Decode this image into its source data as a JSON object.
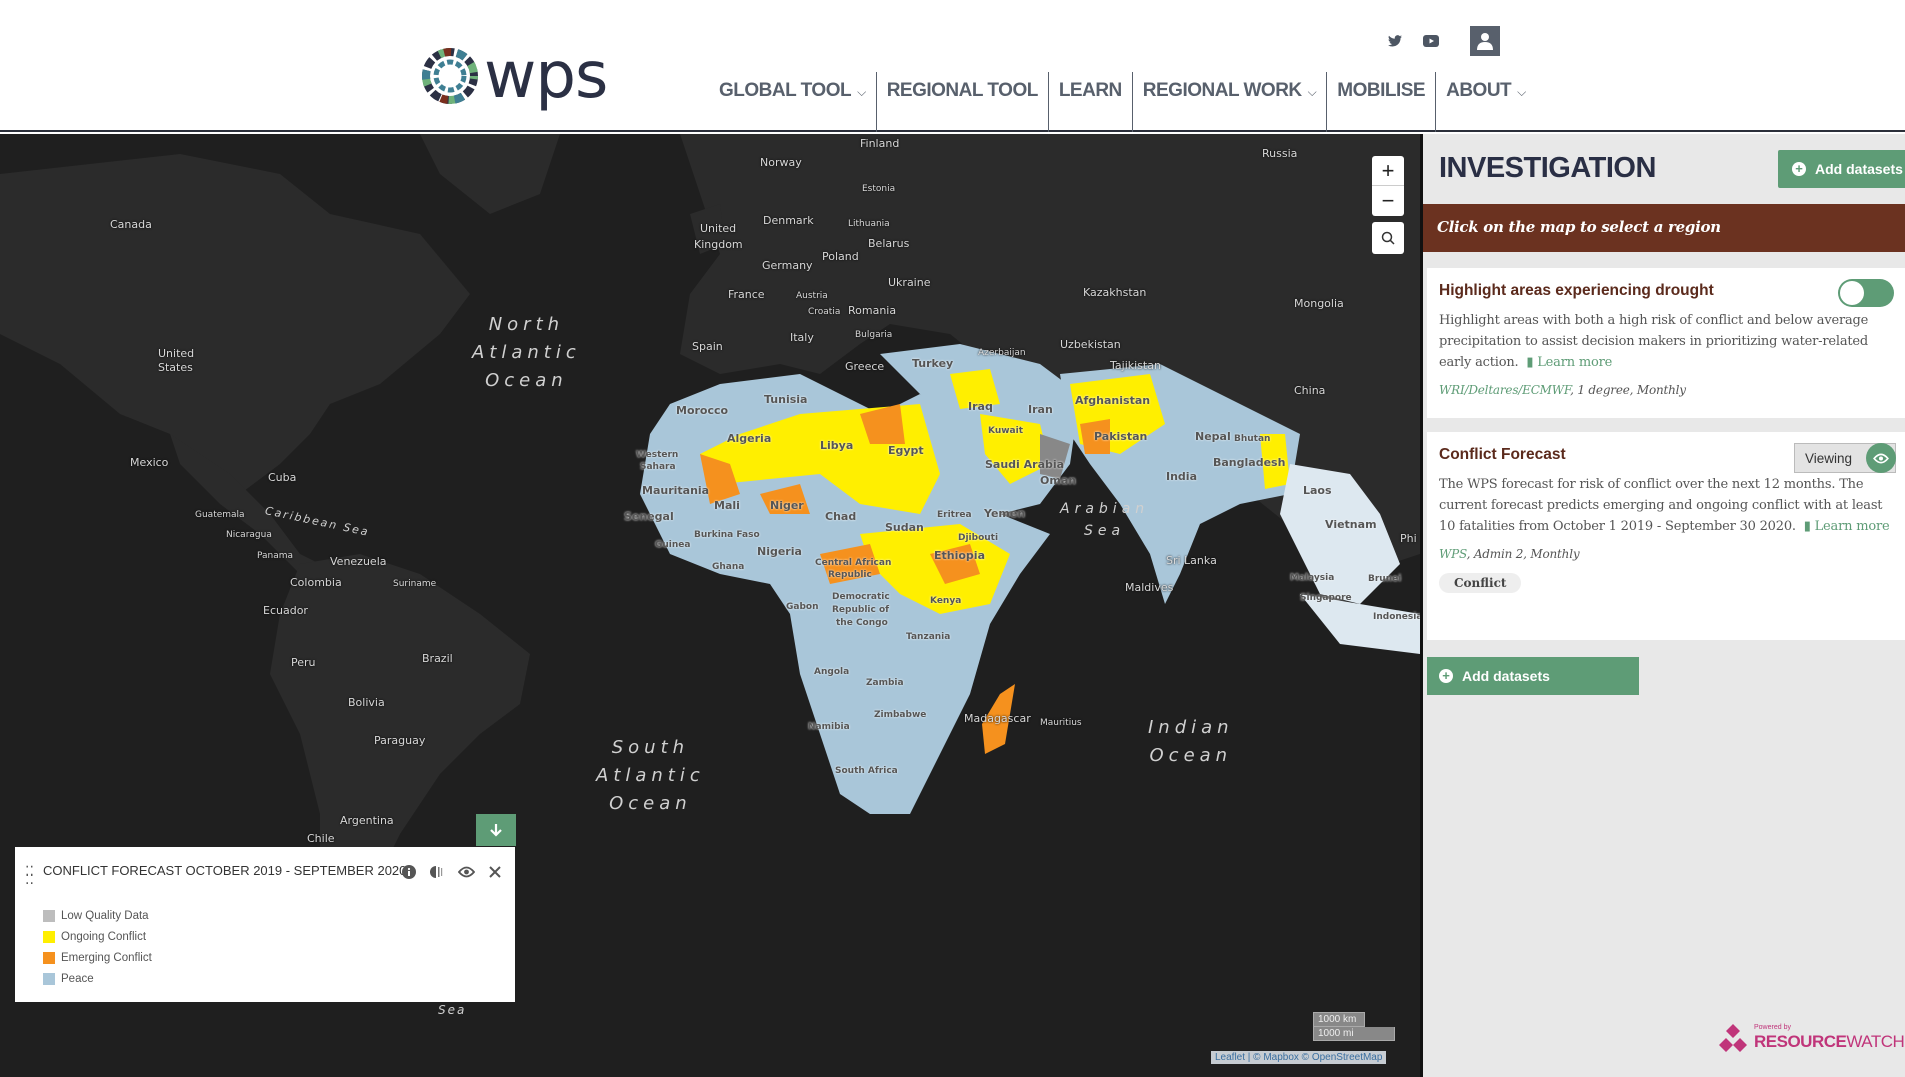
{
  "header": {
    "logo_text": "wps",
    "social": [
      "twitter-icon",
      "youtube-icon"
    ],
    "nav": [
      {
        "label": "GLOBAL TOOL",
        "dropdown": true
      },
      {
        "label": "REGIONAL TOOL",
        "dropdown": false
      },
      {
        "label": "LEARN",
        "dropdown": false
      },
      {
        "label": "REGIONAL WORK",
        "dropdown": true
      },
      {
        "label": "MOBILISE",
        "dropdown": false
      },
      {
        "label": "ABOUT",
        "dropdown": true
      }
    ],
    "chevron": "⌵"
  },
  "map": {
    "labels": {
      "canada": "Canada",
      "us1": "United",
      "us2": "States",
      "mexico": "Mexico",
      "cuba": "Cuba",
      "guatemala": "Guatemala",
      "nicaragua": "Nicaragua",
      "panama": "Panama",
      "venezuela": "Venezuela",
      "colombia": "Colombia",
      "suriname": "Suriname",
      "ecuador": "Ecuador",
      "peru": "Peru",
      "brazil": "Brazil",
      "bolivia": "Bolivia",
      "paraguay": "Paraguay",
      "argentina": "Argentina",
      "chile": "Chile",
      "finland": "Finland",
      "norway": "Norway",
      "estonia": "Estonia",
      "denmark": "Denmark",
      "lithuania": "Lithuania",
      "uk1": "United",
      "uk2": "Kingdom",
      "belarus": "Belarus",
      "poland": "Poland",
      "germany": "Germany",
      "ukraine": "Ukraine",
      "france": "France",
      "austria": "Austria",
      "croatia": "Croatia",
      "romania": "Romania",
      "bulgaria": "Bulgaria",
      "spain": "Spain",
      "italy": "Italy",
      "greece": "Greece",
      "turkey": "Turkey",
      "azerbaijan": "Azerbaijan",
      "russia": "Russia",
      "kazakhstan": "Kazakhstan",
      "mongolia": "Mongolia",
      "uzbekistan": "Uzbekistan",
      "tajikistan": "Tajikistan",
      "china": "China",
      "tunisia": "Tunisia",
      "morocco": "Morocco",
      "algeria": "Algeria",
      "libya": "Libya",
      "egypt": "Egypt",
      "wsahara1": "Western",
      "wsahara2": "Sahara",
      "mauritania": "Mauritania",
      "mali": "Mali",
      "niger": "Niger",
      "senegal": "Senegal",
      "chad": "Chad",
      "sudan": "Sudan",
      "burkina": "Burkina Faso",
      "guinea": "Guinea",
      "ghana": "Ghana",
      "nigeria": "Nigeria",
      "car1": "Central African",
      "car2": "Republic",
      "eritrea": "Eritrea",
      "djibouti": "Djibouti",
      "ethiopia": "Ethiopia",
      "gabon": "Gabon",
      "drc1": "Democratic",
      "drc2": "Republic of",
      "drc3": "the Congo",
      "kenya": "Kenya",
      "tanzania": "Tanzania",
      "angola": "Angola",
      "zambia": "Zambia",
      "zimbabwe": "Zimbabwe",
      "namibia": "Namibia",
      "south_africa": "South Africa",
      "madagascar": "Madagascar",
      "mauritius": "Mauritius",
      "iraq": "Iraq",
      "iran": "Iran",
      "kuwait": "Kuwait",
      "saudi": "Saudi Arabia",
      "yemen": "Yemen",
      "oman": "Oman",
      "afghanistan": "Afghanistan",
      "pakistan": "Pakistan",
      "nepal": "Nepal",
      "bhutan": "Bhutan",
      "india": "India",
      "bangladesh": "Bangladesh",
      "laos": "Laos",
      "vietnam": "Vietnam",
      "srilanka": "Sri Lanka",
      "maldives": "Maldives",
      "malaysia": "Malaysia",
      "singapore": "Singapore",
      "brunei": "Brunei",
      "indonesia": "Indonesia",
      "phil": "Phi"
    },
    "oceans": {
      "north_atlantic": [
        "North",
        "Atlantic",
        "Ocean"
      ],
      "south_atlantic": [
        "South",
        "Atlantic",
        "Ocean"
      ],
      "indian": [
        "Indian",
        "Ocean"
      ],
      "arabian": [
        "Arabian",
        "Sea"
      ],
      "caribbean": "Caribbean Sea",
      "sea": "Sea"
    },
    "zoom_in": "+",
    "zoom_out": "−",
    "scale_km": "1000 km",
    "scale_mi": "1000 mi",
    "attribution": "Leaflet | © Mapbox © OpenStreetMap"
  },
  "legend": {
    "title": "CONFLICT FORECAST OCTOBER 2019 - SEPTEMBER 2020",
    "items": [
      {
        "label": "Low Quality Data",
        "color": "#bdbdbd"
      },
      {
        "label": "Ongoing Conflict",
        "color": "#ffef00"
      },
      {
        "label": "Emerging Conflict",
        "color": "#f5911e"
      },
      {
        "label": "Peace",
        "color": "#a9c6d9"
      }
    ]
  },
  "sidebar": {
    "title": "INVESTIGATION",
    "add_datasets_label": "Add datasets",
    "banner": "Click on the map to select a region",
    "cards": [
      {
        "title": "Highlight areas experiencing drought",
        "description": "Highlight areas with both a high risk of conflict and below average precipitation to assist decision makers in prioritizing water-related early action.",
        "learn_more": "Learn more",
        "source": "WRI/Deltares/ECMWF",
        "meta": ", 1 degree, Monthly",
        "toggle_on": false
      },
      {
        "title": "Conflict Forecast",
        "viewing_label": "Viewing",
        "description": "The WPS forecast for risk of conflict over the next 12 months. The current forecast predicts emerging and ongoing conflict with at least 10 fatalities from October 1 2019 - September 30 2020.",
        "learn_more": "Learn more",
        "source": "WPS",
        "meta": ", Admin 2, Monthly",
        "tag": "Conflict"
      }
    ],
    "powered_by": "Powered by",
    "rw_bold": "RESOURCE",
    "rw_light": "WATCH"
  },
  "colors": {
    "accent_green": "#5e9c76",
    "banner_brown": "#6b3220",
    "brand_pink": "#c0357a"
  }
}
